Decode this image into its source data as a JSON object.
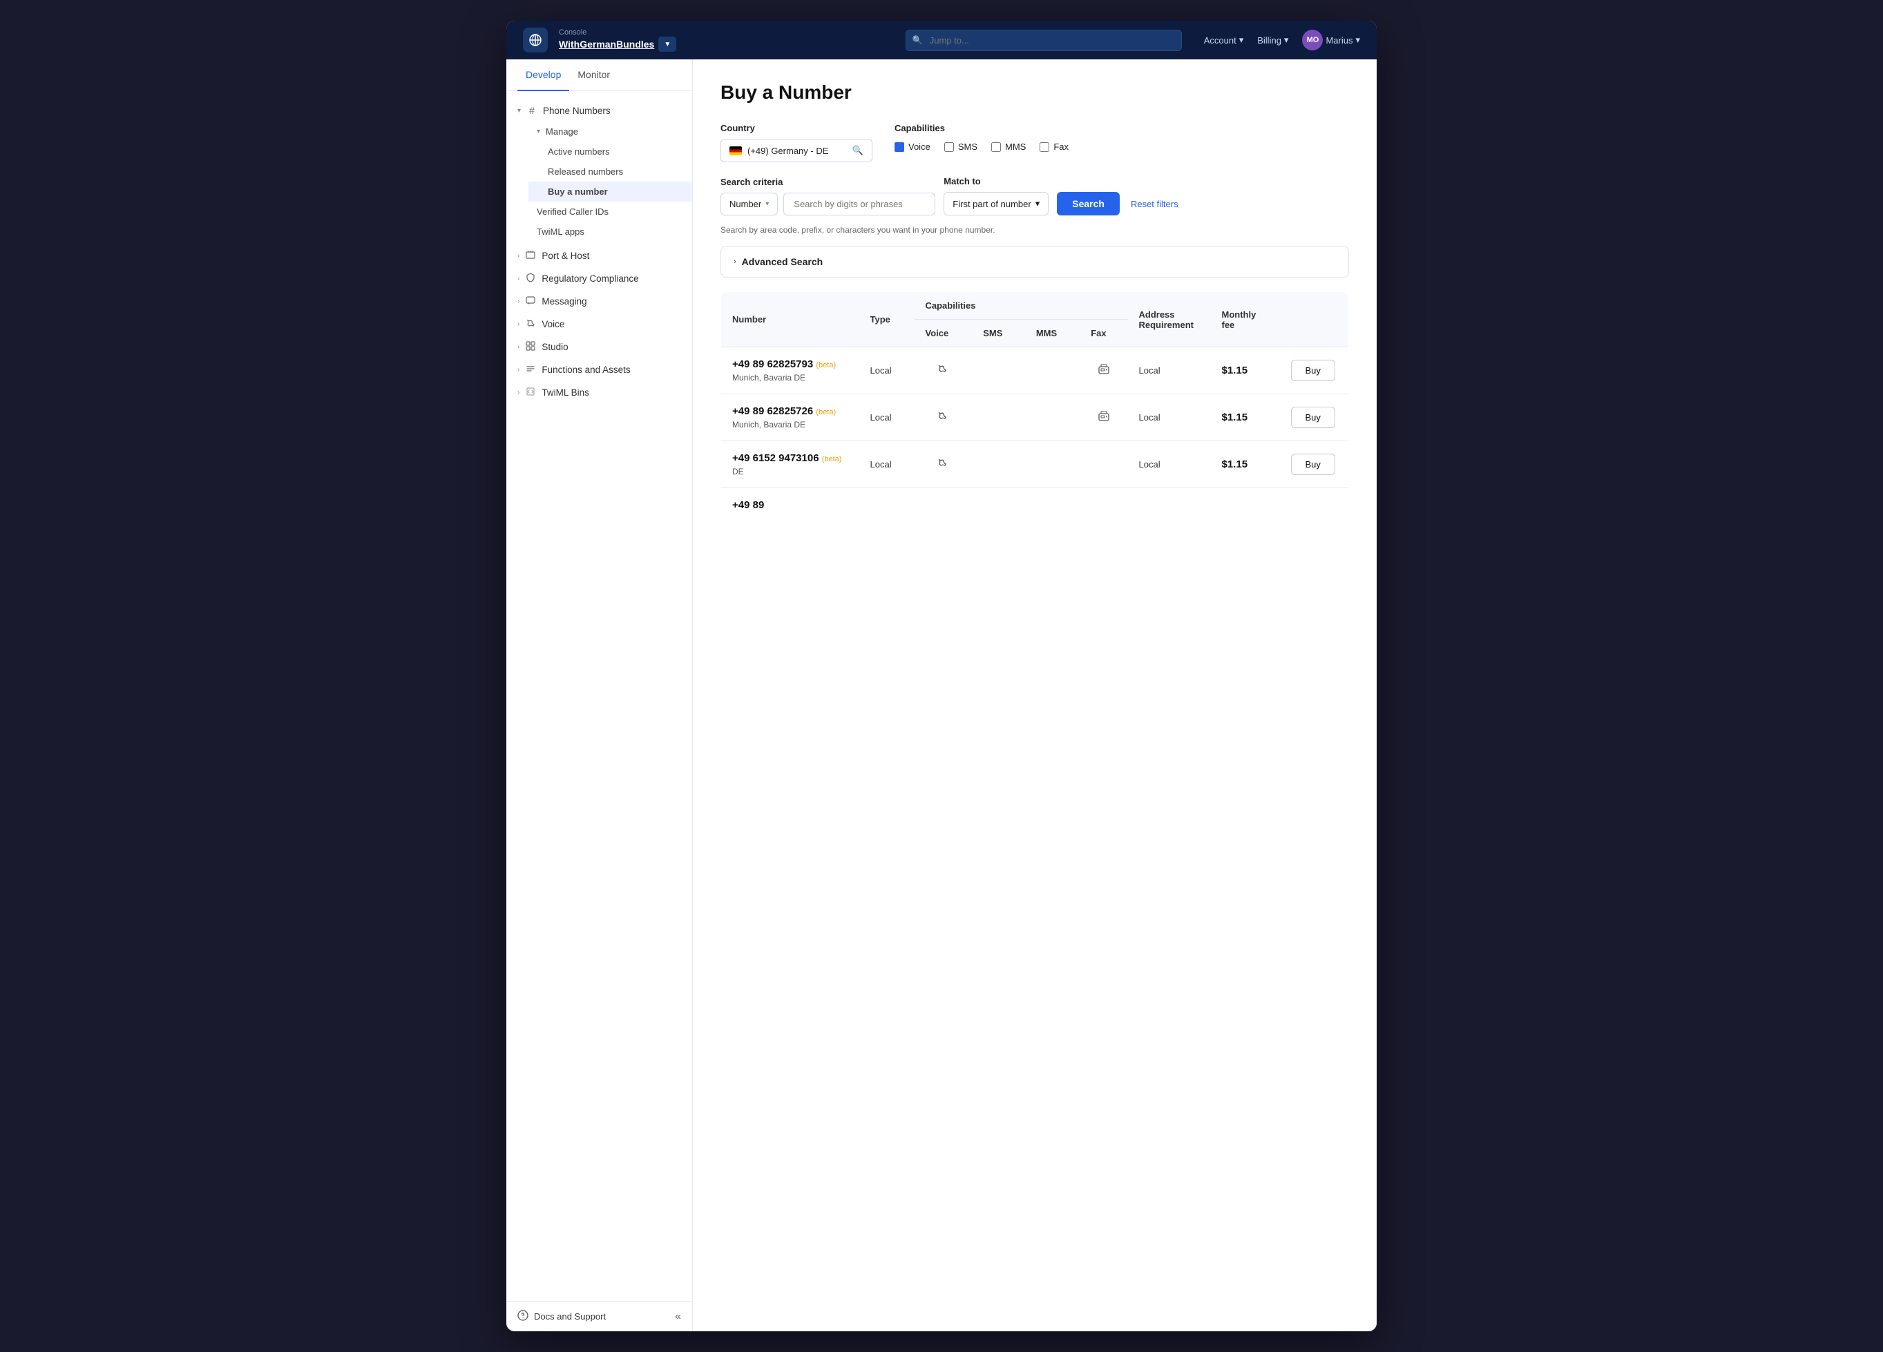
{
  "window": {
    "title": "Buy a Number"
  },
  "topnav": {
    "console_label": "Console",
    "project_name": "WithGermanBundles",
    "search_placeholder": "Jump to...",
    "account_label": "Account",
    "billing_label": "Billing",
    "user_initials": "MO",
    "user_name": "Marius"
  },
  "sidebar": {
    "tabs": [
      "Develop",
      "Monitor"
    ],
    "active_tab": "Develop",
    "sections": [
      {
        "id": "phone-numbers",
        "label": "Phone Numbers",
        "icon": "#",
        "expanded": true,
        "children": [
          {
            "id": "manage",
            "label": "Manage",
            "expanded": true,
            "children": [
              {
                "id": "active-numbers",
                "label": "Active numbers"
              },
              {
                "id": "released-numbers",
                "label": "Released numbers"
              },
              {
                "id": "buy-number",
                "label": "Buy a number",
                "selected": true
              }
            ]
          },
          {
            "id": "verified-caller-ids",
            "label": "Verified Caller IDs"
          },
          {
            "id": "twiml-apps",
            "label": "TwiML apps"
          }
        ]
      },
      {
        "id": "port-host",
        "label": "Port & Host",
        "hasArrow": true
      },
      {
        "id": "regulatory-compliance",
        "label": "Regulatory Compliance",
        "hasArrow": true
      },
      {
        "id": "messaging",
        "label": "Messaging",
        "hasArrow": true
      },
      {
        "id": "voice",
        "label": "Voice",
        "hasArrow": true
      },
      {
        "id": "studio",
        "label": "Studio",
        "hasArrow": true
      },
      {
        "id": "functions-assets",
        "label": "Functions and Assets",
        "hasArrow": true
      },
      {
        "id": "twiml-bins",
        "label": "TwiML Bins",
        "hasArrow": true
      }
    ],
    "footer": {
      "docs_label": "Docs and Support",
      "collapse_icon": "«"
    }
  },
  "page": {
    "title": "Buy a Number",
    "country_label": "Country",
    "country_value": "(+49) Germany - DE",
    "capabilities_label": "Capabilities",
    "capabilities": [
      {
        "id": "voice",
        "label": "Voice",
        "checked": true
      },
      {
        "id": "sms",
        "label": "SMS",
        "checked": false
      },
      {
        "id": "mms",
        "label": "MMS",
        "checked": false
      },
      {
        "id": "fax",
        "label": "Fax",
        "checked": false
      }
    ],
    "search_criteria_label": "Search criteria",
    "search_criteria_value": "Number",
    "search_placeholder": "Search by digits or phrases",
    "match_to_label": "Match to",
    "match_to_value": "First part of number",
    "search_button": "Search",
    "reset_button": "Reset filters",
    "search_hint": "Search by area code, prefix, or characters you want in your phone number.",
    "advanced_search_label": "Advanced Search",
    "table": {
      "headers": {
        "number": "Number",
        "type": "Type",
        "capabilities": "Capabilities",
        "address_req": "Address Requirement",
        "monthly_fee": "Monthly fee"
      },
      "cap_sub_headers": [
        "Voice",
        "SMS",
        "MMS",
        "Fax"
      ],
      "rows": [
        {
          "number": "+49 89 62825793",
          "badge": "(beta)",
          "type": "Local",
          "voice": true,
          "sms": false,
          "mms": false,
          "fax": true,
          "address_req": "Local",
          "monthly_fee": "$1.15",
          "location": "Munich, Bavaria DE"
        },
        {
          "number": "+49 89 62825726",
          "badge": "(beta)",
          "type": "Local",
          "voice": true,
          "sms": false,
          "mms": false,
          "fax": true,
          "address_req": "Local",
          "monthly_fee": "$1.15",
          "location": "Munich, Bavaria DE"
        },
        {
          "number": "+49 6152 9473106",
          "badge": "(beta)",
          "type": "Local",
          "voice": true,
          "sms": false,
          "mms": false,
          "fax": false,
          "address_req": "Local",
          "monthly_fee": "$1.15",
          "location": "DE"
        },
        {
          "number": "+49 89",
          "badge": "",
          "type": "",
          "voice": false,
          "sms": false,
          "mms": false,
          "fax": false,
          "address_req": "",
          "monthly_fee": "",
          "location": ""
        }
      ],
      "buy_button": "Buy"
    }
  }
}
